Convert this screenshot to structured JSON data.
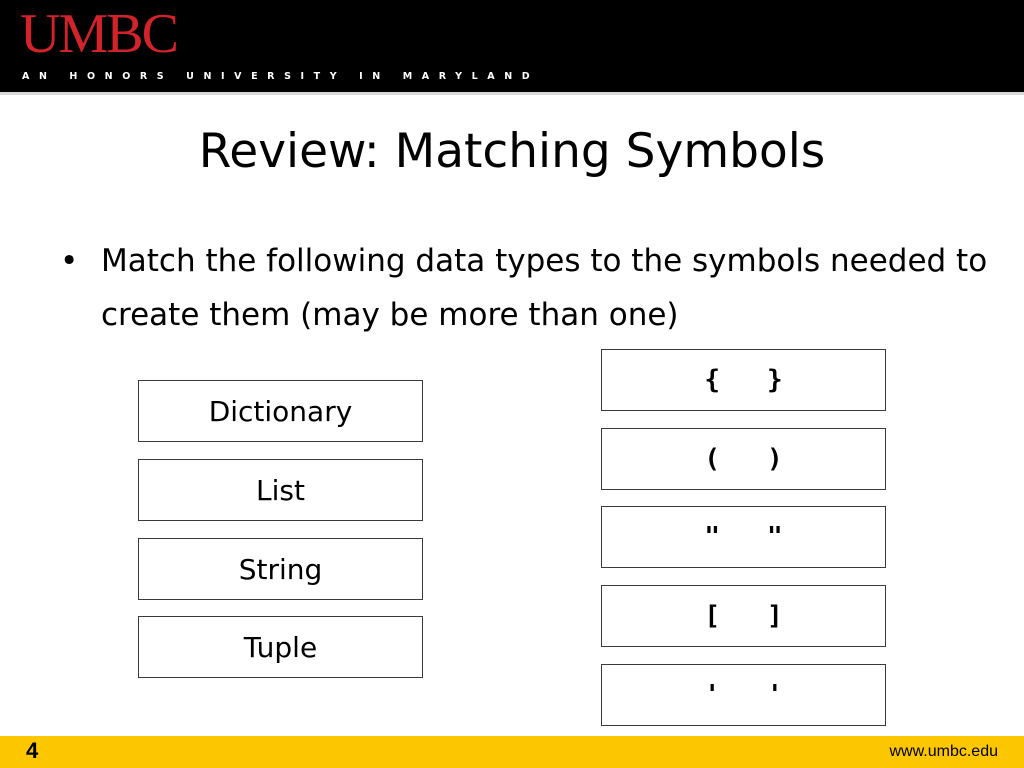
{
  "header": {
    "logo": "UMBC",
    "tagline": "AN HONORS UNIVERSITY IN MARYLAND",
    "brand_red": "#d2232a"
  },
  "slide": {
    "title": "Review: Matching Symbols",
    "bullet_marker": "•",
    "bullet": "Match the following data types to the symbols needed to create them (may be more than one)",
    "data_types": [
      "Dictionary",
      "List",
      "String",
      "Tuple"
    ],
    "symbols": [
      "{   }",
      "(   )",
      "\"   \"",
      "[   ]",
      "'   '"
    ]
  },
  "footer": {
    "page_number": "4",
    "url": "www.umbc.edu",
    "accent": "#fdc700"
  }
}
